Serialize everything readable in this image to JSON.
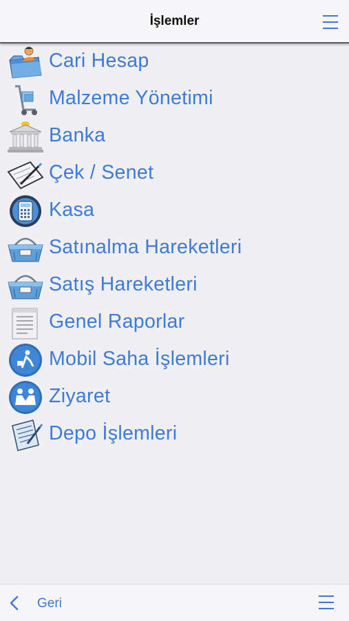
{
  "navbar": {
    "title": "İşlemler",
    "menu_icon": "hamburger-icon"
  },
  "menu": [
    {
      "label": "Cari Hesap",
      "icon": "folder-person-icon"
    },
    {
      "label": "Malzeme Yönetimi",
      "icon": "hand-truck-icon"
    },
    {
      "label": "Banka",
      "icon": "bank-building-icon"
    },
    {
      "label": "Çek / Senet",
      "icon": "cheque-pen-icon"
    },
    {
      "label": "Kasa",
      "icon": "calculator-icon"
    },
    {
      "label": "Satınalma Hareketleri",
      "icon": "shopping-basket-icon"
    },
    {
      "label": "Satış Hareketleri",
      "icon": "shopping-basket-icon"
    },
    {
      "label": "Genel Raporlar",
      "icon": "report-document-icon"
    },
    {
      "label": "Mobil Saha İşlemleri",
      "icon": "field-worker-icon"
    },
    {
      "label": "Ziyaret",
      "icon": "handshake-people-icon"
    },
    {
      "label": "Depo İşlemleri",
      "icon": "clipboard-pen-icon"
    }
  ],
  "toolbar": {
    "back_label": "Geri",
    "back_icon": "chevron-left-icon",
    "menu_icon": "hamburger-icon"
  },
  "colors": {
    "accent": "#3c77d9",
    "label": "#3e7ad8",
    "background": "#efeff4",
    "bar": "#f7f7f9"
  }
}
